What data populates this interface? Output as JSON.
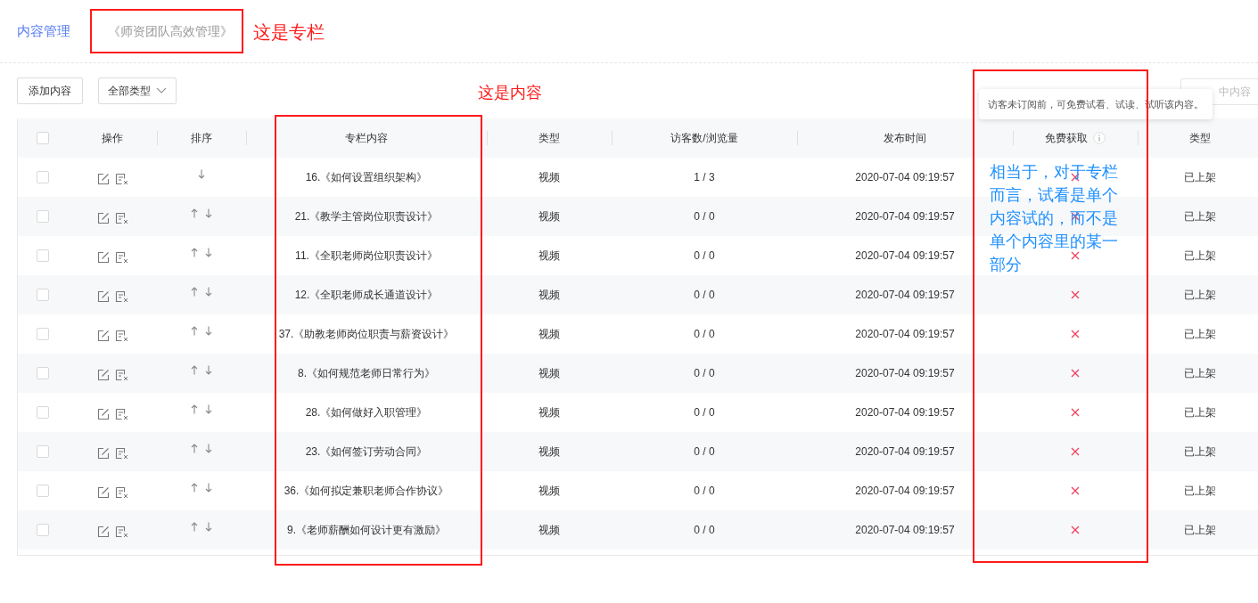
{
  "breadcrumb": [
    {
      "label": "内容管理",
      "kind": "link"
    },
    {
      "label": "《师资团队高效管理》",
      "kind": "current"
    }
  ],
  "toolbar": {
    "add_button": "添加内容",
    "type_filter": "全部类型",
    "remove_button": "中内容"
  },
  "tooltip": "访客未订阅前，可免费试看、试读、试听该内容。",
  "table": {
    "select_all_checked": false,
    "columns": [
      "操作",
      "排序",
      "专栏内容",
      "类型",
      "访客数/浏览量",
      "发布时间",
      "免费获取",
      "类型"
    ],
    "rows": [
      {
        "checked": false,
        "up": false,
        "down": true,
        "title": "16.《如何设置组织架构》",
        "type": "视频",
        "visits": "1 / 3",
        "time": "2020-07-04 09:19:57",
        "free": false,
        "status": "已上架"
      },
      {
        "checked": false,
        "up": true,
        "down": true,
        "title": "21.《教学主管岗位职责设计》",
        "type": "视频",
        "visits": "0 / 0",
        "time": "2020-07-04 09:19:57",
        "free": false,
        "status": "已上架"
      },
      {
        "checked": false,
        "up": true,
        "down": true,
        "title": "11.《全职老师岗位职责设计》",
        "type": "视频",
        "visits": "0 / 0",
        "time": "2020-07-04 09:19:57",
        "free": false,
        "status": "已上架"
      },
      {
        "checked": false,
        "up": true,
        "down": true,
        "title": "12.《全职老师成长通道设计》",
        "type": "视频",
        "visits": "0 / 0",
        "time": "2020-07-04 09:19:57",
        "free": false,
        "status": "已上架"
      },
      {
        "checked": false,
        "up": true,
        "down": true,
        "title": "37.《助教老师岗位职责与薪资设计》",
        "type": "视频",
        "visits": "0 / 0",
        "time": "2020-07-04 09:19:57",
        "free": false,
        "status": "已上架"
      },
      {
        "checked": false,
        "up": true,
        "down": true,
        "title": "8.《如何规范老师日常行为》",
        "type": "视频",
        "visits": "0 / 0",
        "time": "2020-07-04 09:19:57",
        "free": false,
        "status": "已上架"
      },
      {
        "checked": false,
        "up": true,
        "down": true,
        "title": "28.《如何做好入职管理》",
        "type": "视频",
        "visits": "0 / 0",
        "time": "2020-07-04 09:19:57",
        "free": false,
        "status": "已上架"
      },
      {
        "checked": false,
        "up": true,
        "down": true,
        "title": "23.《如何签订劳动合同》",
        "type": "视频",
        "visits": "0 / 0",
        "time": "2020-07-04 09:19:57",
        "free": false,
        "status": "已上架"
      },
      {
        "checked": false,
        "up": true,
        "down": true,
        "title": "36.《如何拟定兼职老师合作协议》",
        "type": "视频",
        "visits": "0 / 0",
        "time": "2020-07-04 09:19:57",
        "free": false,
        "status": "已上架"
      },
      {
        "checked": false,
        "up": true,
        "down": true,
        "title": "9.《老师薪酬如何设计更有激励》",
        "type": "视频",
        "visits": "0 / 0",
        "time": "2020-07-04 09:19:57",
        "free": false,
        "status": "已上架"
      }
    ]
  },
  "annotations": [
    {
      "kind": "column_note",
      "text": "这是专栏"
    },
    {
      "kind": "content_note",
      "text": "这是内容"
    },
    {
      "kind": "free_note",
      "text": "相当于，对于专栏而言，试看是单个内容试的，而不是单个内容里的某一部分"
    }
  ]
}
